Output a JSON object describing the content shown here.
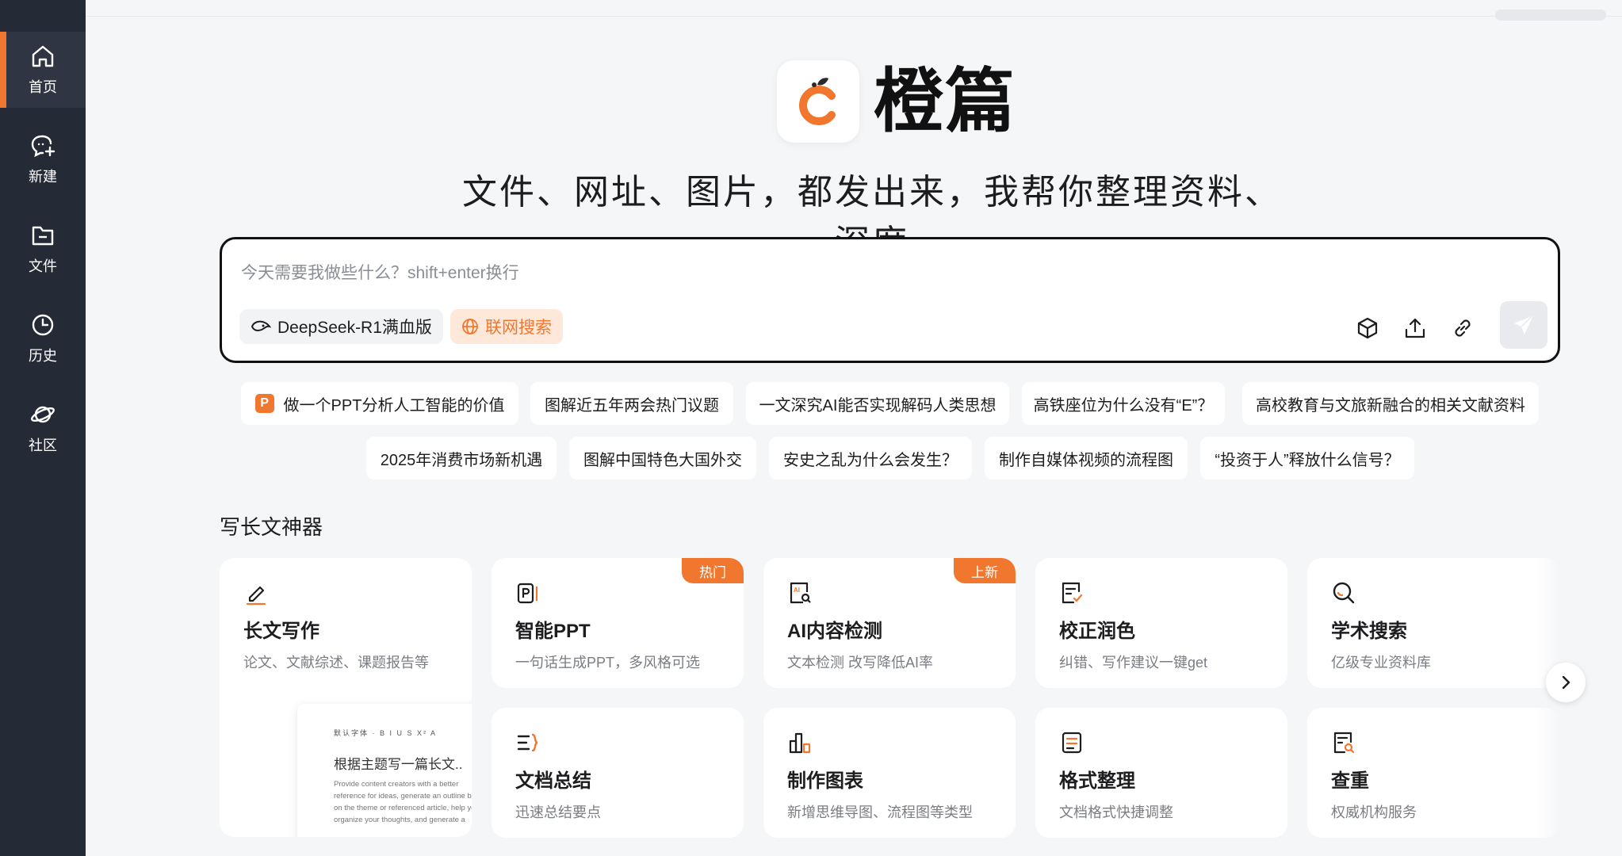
{
  "sidebar": {
    "items": [
      {
        "label": "首页",
        "icon": "home-icon",
        "active": true
      },
      {
        "label": "新建",
        "icon": "new-chat-icon"
      },
      {
        "label": "文件",
        "icon": "folder-icon"
      },
      {
        "label": "历史",
        "icon": "clock-icon"
      },
      {
        "label": "社区",
        "icon": "planet-icon"
      }
    ]
  },
  "brand": {
    "name": "橙篇",
    "accent": "#f2772e"
  },
  "tagline": "文件、网址、图片，都发出来，我帮你整理资料、深度",
  "input": {
    "placeholder": "今天需要我做些什么？shift+enter换行",
    "model_chip": "DeepSeek-R1满血版",
    "search_chip": "联网搜索"
  },
  "suggestions": {
    "row1": [
      "做一个PPT分析人工智能的价值",
      "图解近五年两会热门议题",
      "一文深究AI能否实现解码人类思想",
      "高铁座位为什么没有“E”？",
      "高校教育与文旅新融合的相关文献资料"
    ],
    "row2": [
      "2025年消费市场新机遇",
      "图解中国特色大国外交",
      "安史之乱为什么会发生？",
      "制作自媒体视频的流程图",
      "“投资于人”释放什么信号？"
    ]
  },
  "section": {
    "title": "写长文神器"
  },
  "cards": [
    {
      "title": "长文写作",
      "desc": "论文、文献综述、课题报告等",
      "icon": "pen-icon"
    },
    {
      "title": "智能PPT",
      "desc": "一句话生成PPT，多风格可选",
      "badge": "热门",
      "icon": "ppt-icon"
    },
    {
      "title": "AI内容检测",
      "desc": "文本检测 改写降低AI率",
      "badge": "上新",
      "icon": "ai-detect-icon"
    },
    {
      "title": "校正润色",
      "desc": "纠错、写作建议一键get",
      "icon": "proofread-icon"
    },
    {
      "title": "学术搜索",
      "desc": "亿级专业资料库",
      "icon": "search-icon"
    },
    {
      "title": "文档总结",
      "desc": "迅速总结要点",
      "icon": "summary-icon"
    },
    {
      "title": "制作图表",
      "desc": "新增思维导图、流程图等类型",
      "icon": "chart-icon"
    },
    {
      "title": "格式整理",
      "desc": "文档格式快捷调整",
      "icon": "format-icon"
    },
    {
      "title": "查重",
      "desc": "权威机构服务",
      "icon": "duplicate-check-icon"
    }
  ],
  "preview": {
    "toolbar": "默认字体 · B I U S X² A",
    "title": "根据主题写一篇长文..",
    "text": "Provide content creators with a better reference for ideas, generate an outline based on the theme or referenced article, help you organize your thoughts, and generate a"
  }
}
